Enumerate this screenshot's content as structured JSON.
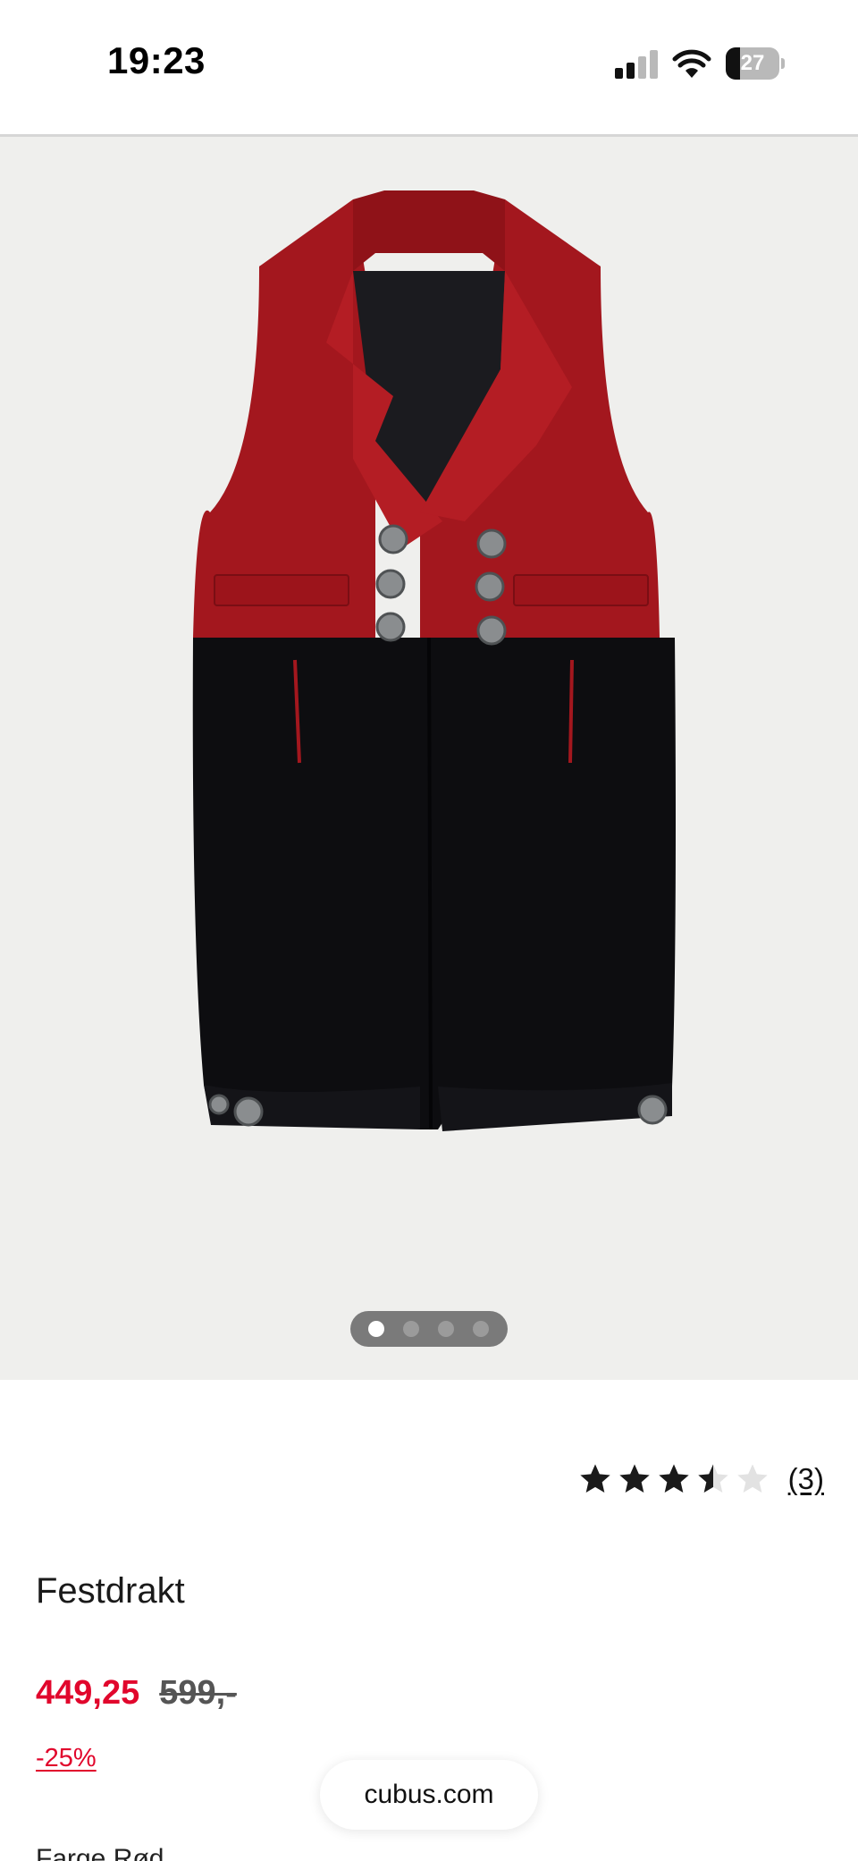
{
  "status_bar": {
    "time": "19:23",
    "battery_level": "27",
    "icons": [
      "cellular-signal-icon",
      "wifi-icon",
      "battery-icon"
    ]
  },
  "gallery": {
    "image_description_icon": "product-photo-festdrakt",
    "page_count": 4,
    "active_page": 1
  },
  "product": {
    "rating": 3.5,
    "rating_max": 5,
    "rating_count": "(3)",
    "title": "Festdrakt",
    "price_current": "449,25",
    "price_original": "599,-",
    "discount": "-25%"
  },
  "browser": {
    "url": "cubus.com"
  },
  "below_fold_text": "Farge Rød",
  "colors": {
    "sale_red": "#e1062c",
    "gallery_bg": "#efefed",
    "vest_red": "#a3171e",
    "pants_black": "#0d0d10"
  }
}
